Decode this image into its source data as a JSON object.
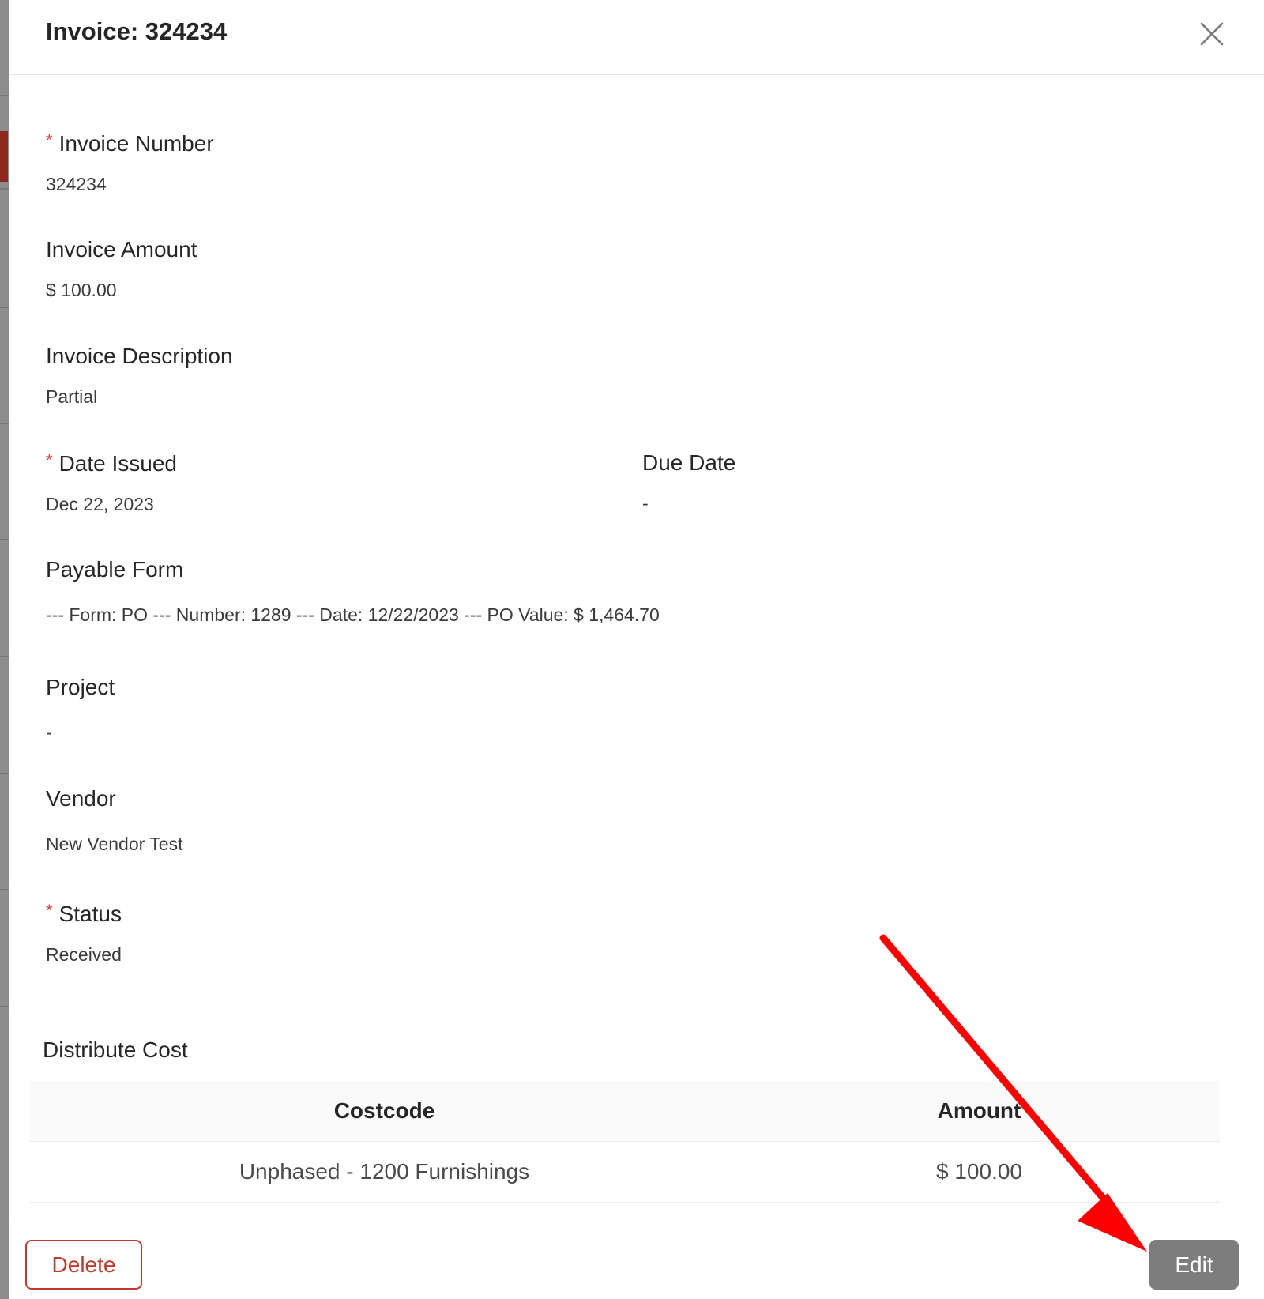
{
  "modal": {
    "title": "Invoice: 324234"
  },
  "fields": {
    "invoice_number": {
      "label": "Invoice Number",
      "required": "*",
      "value": "324234"
    },
    "invoice_amount": {
      "label": "Invoice Amount",
      "value": "$ 100.00"
    },
    "invoice_description": {
      "label": "Invoice Description",
      "value": "Partial"
    },
    "date_issued": {
      "label": "Date Issued",
      "required": "*",
      "value": "Dec 22, 2023"
    },
    "due_date": {
      "label": "Due Date",
      "value": "-"
    },
    "payable_form": {
      "label": "Payable Form",
      "value": "--- Form: PO --- Number: 1289 --- Date: 12/22/2023 --- PO Value: $ 1,464.70"
    },
    "project": {
      "label": "Project",
      "value": "-"
    },
    "vendor": {
      "label": "Vendor",
      "value": "New Vendor Test"
    },
    "status": {
      "label": "Status",
      "required": "*",
      "value": "Received"
    }
  },
  "distribute_cost": {
    "title": "Distribute Cost",
    "columns": [
      "Costcode",
      "Amount"
    ],
    "rows": [
      {
        "costcode": "Unphased - 1200 Furnishings",
        "amount": "$ 100.00"
      }
    ]
  },
  "footer": {
    "delete_label": "Delete",
    "edit_label": "Edit"
  },
  "icons": {
    "close": "close-icon",
    "annotation": "red-arrow-annotation"
  },
  "colors": {
    "required": "#e5383b",
    "delete": "#c0392b",
    "edit_bg": "#7d7d7d",
    "annotation": "#ff0000"
  }
}
